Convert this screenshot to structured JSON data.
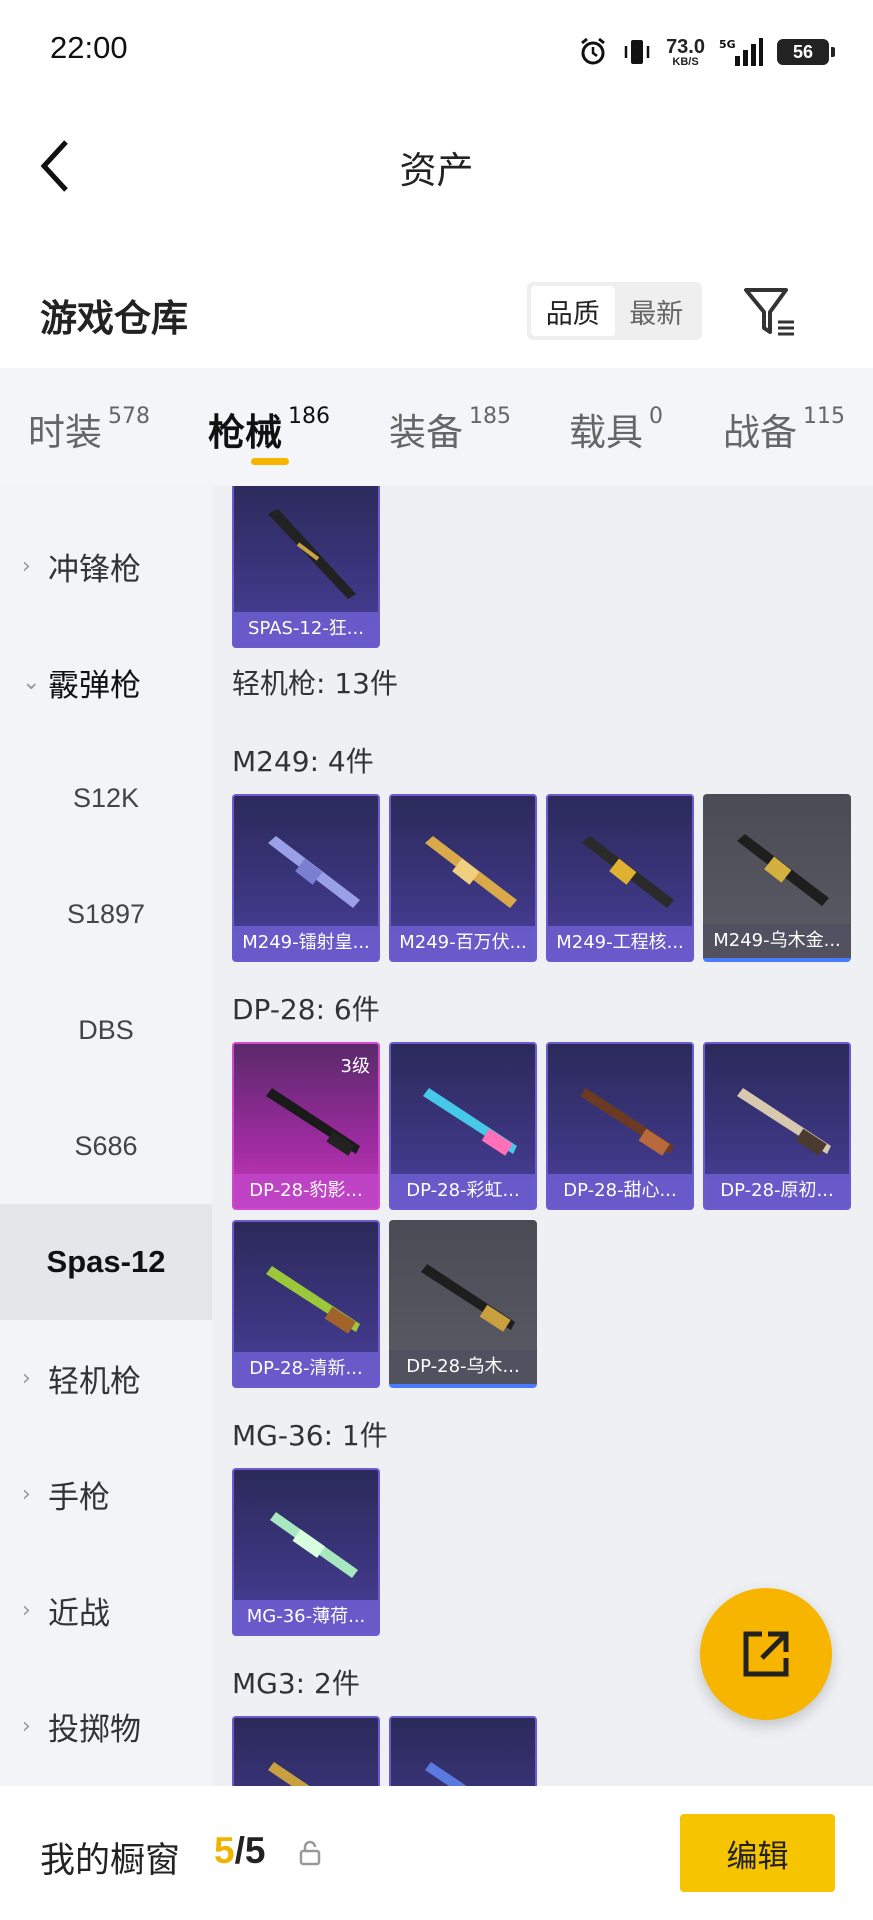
{
  "status_bar": {
    "time": "22:00",
    "net_speed": "73.0",
    "net_unit": "KB/S",
    "network": "5G",
    "battery": "56"
  },
  "nav": {
    "title": "资产"
  },
  "header": {
    "section_title": "游戏仓库",
    "sort_options": [
      "品质",
      "最新"
    ],
    "sort_selected": "品质"
  },
  "tabs": [
    {
      "label": "时装",
      "count": "578"
    },
    {
      "label": "枪械",
      "count": "186",
      "active": true
    },
    {
      "label": "装备",
      "count": "185"
    },
    {
      "label": "载具",
      "count": "0"
    },
    {
      "label": "战备",
      "count": "115"
    }
  ],
  "sidebar": {
    "items": [
      {
        "label": "冲锋枪"
      },
      {
        "label": "霰弹枪"
      },
      {
        "label": "S12K"
      },
      {
        "label": "S1897"
      },
      {
        "label": "DBS"
      },
      {
        "label": "S686"
      },
      {
        "label": "Spas-12"
      },
      {
        "label": "轻机枪"
      },
      {
        "label": "手枪"
      },
      {
        "label": "近战"
      },
      {
        "label": "投掷物"
      }
    ]
  },
  "content": {
    "top_card": {
      "name": "SPAS-12-狂..."
    },
    "lmg_header": "轻机枪: 13件",
    "m249": {
      "label": "M249: 4件",
      "items": [
        "M249-镭射皇...",
        "M249-百万伏...",
        "M249-工程核...",
        "M249-乌木金..."
      ]
    },
    "dp28": {
      "label": "DP-28: 6件",
      "items": [
        "DP-28-豹影...",
        "DP-28-彩虹...",
        "DP-28-甜心...",
        "DP-28-原初...",
        "DP-28-清新...",
        "DP-28-乌木..."
      ],
      "level_badge": "3级"
    },
    "mg36": {
      "label": "MG-36: 1件",
      "items": [
        "MG-36-薄荷..."
      ]
    },
    "mg3": {
      "label": "MG3: 2件"
    }
  },
  "bottom": {
    "showcase_label": "我的橱窗",
    "showcase_current": "5",
    "showcase_sep": "/",
    "showcase_total": "5",
    "edit_label": "编辑"
  },
  "colors": {
    "accent": "#f7b500",
    "edit_button": "#f7c400",
    "card_border": "#6b5bd0",
    "pink_card": "#c93ab8"
  }
}
